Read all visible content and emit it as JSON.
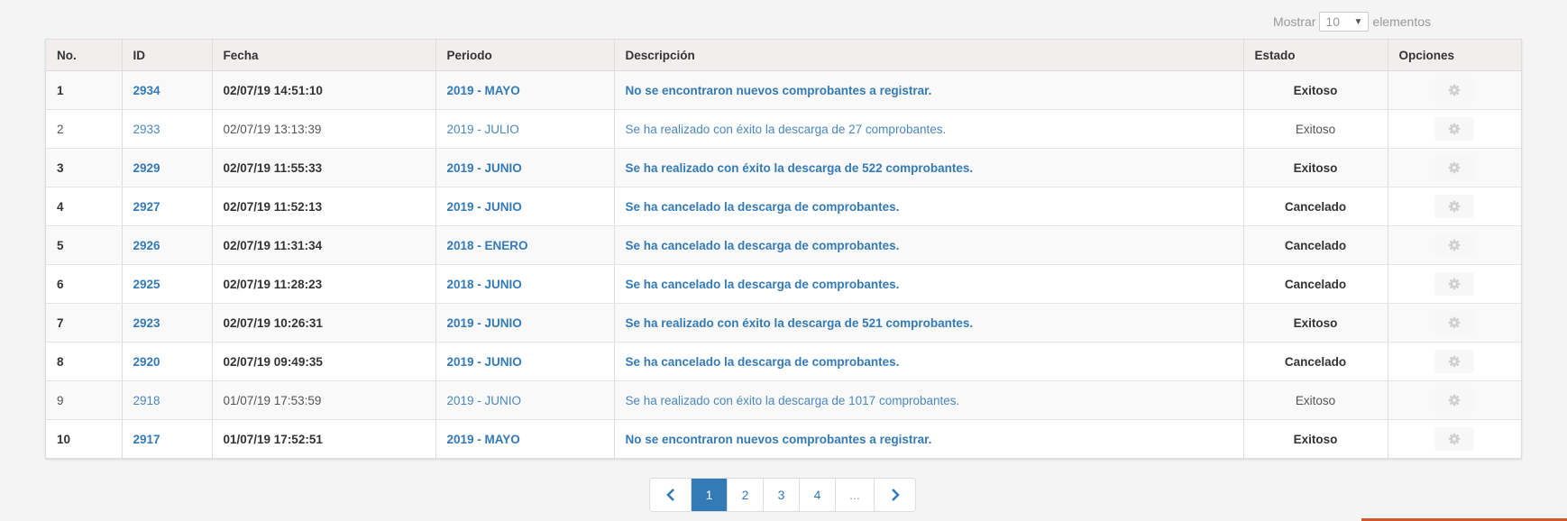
{
  "length_control": {
    "prefix": "Mostrar",
    "value": "10",
    "suffix": "elementos"
  },
  "table": {
    "headers": [
      "No.",
      "ID",
      "Fecha",
      "Periodo",
      "Descripción",
      "Estado",
      "Opciones"
    ],
    "rows": [
      {
        "no": "1",
        "id": "2934",
        "fecha": "02/07/19 14:51:10",
        "periodo": "2019 - MAYO",
        "descripcion": "No se encontraron nuevos comprobantes a registrar.",
        "estado": "Exitoso",
        "bold": true
      },
      {
        "no": "2",
        "id": "2933",
        "fecha": "02/07/19 13:13:39",
        "periodo": "2019 - JULIO",
        "descripcion": "Se ha realizado con éxito la descarga de 27 comprobantes.",
        "estado": "Exitoso",
        "bold": false
      },
      {
        "no": "3",
        "id": "2929",
        "fecha": "02/07/19 11:55:33",
        "periodo": "2019 - JUNIO",
        "descripcion": "Se ha realizado con éxito la descarga de 522 comprobantes.",
        "estado": "Exitoso",
        "bold": true
      },
      {
        "no": "4",
        "id": "2927",
        "fecha": "02/07/19 11:52:13",
        "periodo": "2019 - JUNIO",
        "descripcion": "Se ha cancelado la descarga de comprobantes.",
        "estado": "Cancelado",
        "bold": true
      },
      {
        "no": "5",
        "id": "2926",
        "fecha": "02/07/19 11:31:34",
        "periodo": "2018 - ENERO",
        "descripcion": "Se ha cancelado la descarga de comprobantes.",
        "estado": "Cancelado",
        "bold": true
      },
      {
        "no": "6",
        "id": "2925",
        "fecha": "02/07/19 11:28:23",
        "periodo": "2018 - JUNIO",
        "descripcion": "Se ha cancelado la descarga de comprobantes.",
        "estado": "Cancelado",
        "bold": true
      },
      {
        "no": "7",
        "id": "2923",
        "fecha": "02/07/19 10:26:31",
        "periodo": "2019 - JUNIO",
        "descripcion": "Se ha realizado con éxito la descarga de 521 comprobantes.",
        "estado": "Exitoso",
        "bold": true
      },
      {
        "no": "8",
        "id": "2920",
        "fecha": "02/07/19 09:49:35",
        "periodo": "2019 - JUNIO",
        "descripcion": "Se ha cancelado la descarga de comprobantes.",
        "estado": "Cancelado",
        "bold": true
      },
      {
        "no": "9",
        "id": "2918",
        "fecha": "01/07/19 17:53:59",
        "periodo": "2019 - JUNIO",
        "descripcion": "Se ha realizado con éxito la descarga de 1017 comprobantes.",
        "estado": "Exitoso",
        "bold": false
      },
      {
        "no": "10",
        "id": "2917",
        "fecha": "01/07/19 17:52:51",
        "periodo": "2019 - MAYO",
        "descripcion": "No se encontraron nuevos comprobantes a registrar.",
        "estado": "Exitoso",
        "bold": true
      }
    ],
    "row_option_icon": "gear-icon"
  },
  "pagination": {
    "prev_icon": "chevron-left-icon",
    "next_icon": "chevron-right-icon",
    "pages": [
      "1",
      "2",
      "3",
      "4",
      "..."
    ],
    "active": "1"
  },
  "colors": {
    "link": "#337ab7",
    "active_page": "#337ab7",
    "accent_bar": "#d2582b"
  }
}
